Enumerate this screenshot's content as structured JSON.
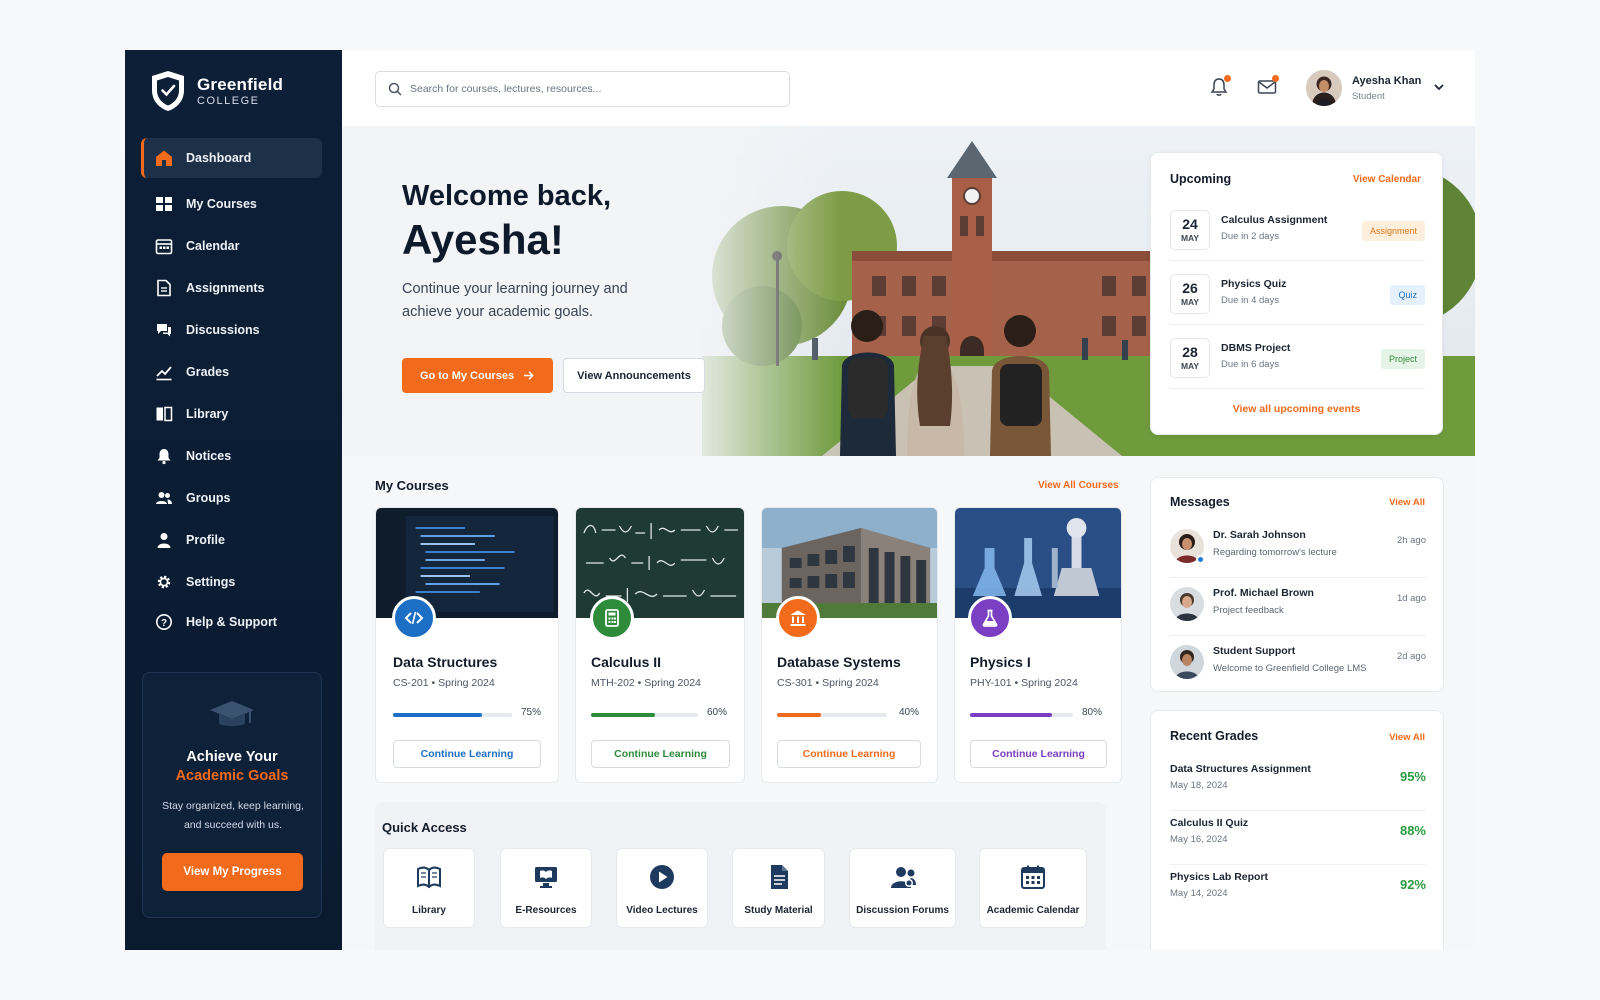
{
  "brand": {
    "name": "Greenfield",
    "sub": "COLLEGE"
  },
  "nav": [
    {
      "label": "Dashboard",
      "icon": "home-icon",
      "active": true
    },
    {
      "label": "My Courses",
      "icon": "courses-icon"
    },
    {
      "label": "Calendar",
      "icon": "calendar-icon"
    },
    {
      "label": "Assignments",
      "icon": "document-icon"
    },
    {
      "label": "Discussions",
      "icon": "chat-icon"
    },
    {
      "label": "Grades",
      "icon": "chart-icon"
    },
    {
      "label": "Library",
      "icon": "book-icon"
    },
    {
      "label": "Notices",
      "icon": "bell-icon"
    },
    {
      "label": "Groups",
      "icon": "group-icon"
    },
    {
      "label": "Profile",
      "icon": "user-icon"
    },
    {
      "label": "Settings",
      "icon": "gear-icon"
    },
    {
      "label": "Help & Support",
      "icon": "help-icon"
    }
  ],
  "goal_card": {
    "title": "Achieve Your",
    "title_accent": "Academic Goals",
    "desc": "Stay organized, keep learning, and succeed with us.",
    "button": "View My Progress"
  },
  "search": {
    "placeholder": "Search for courses, lectures, resources..."
  },
  "user": {
    "name": "Ayesha Khan",
    "role": "Student"
  },
  "hero": {
    "line1": "Welcome back,",
    "line2": "Ayesha!",
    "desc": "Continue your learning journey and achieve your academic goals.",
    "primary_button": "Go to My Courses",
    "secondary_button": "View Announcements"
  },
  "upcoming": {
    "title": "Upcoming",
    "link": "View Calendar",
    "items": [
      {
        "day": "24",
        "month": "MAY",
        "title": "Calculus Assignment",
        "sub": "Due in 2 days",
        "tag": "Assignment"
      },
      {
        "day": "26",
        "month": "MAY",
        "title": "Physics Quiz",
        "sub": "Due in 4 days",
        "tag": "Quiz"
      },
      {
        "day": "28",
        "month": "MAY",
        "title": "DBMS Project",
        "sub": "Due in 6 days",
        "tag": "Project"
      }
    ],
    "footer": "View all upcoming events"
  },
  "courses": {
    "title": "My Courses",
    "link": "View All Courses",
    "items": [
      {
        "name": "Data Structures",
        "code": "CS-201 • Spring 2024",
        "progress": 75,
        "progress_label": "75%",
        "button": "Continue Learning",
        "color": "#1c6fc4",
        "icon": "code-icon"
      },
      {
        "name": "Calculus II",
        "code": "MTH-202 • Spring 2024",
        "progress": 60,
        "progress_label": "60%",
        "button": "Continue Learning",
        "color": "#2e8b3a",
        "icon": "calculator-icon"
      },
      {
        "name": "Database Systems",
        "code": "CS-301 • Spring 2024",
        "progress": 40,
        "progress_label": "40%",
        "button": "Continue Learning",
        "color": "#f26a1b",
        "icon": "building-icon"
      },
      {
        "name": "Physics I",
        "code": "PHY-101 • Spring 2024",
        "progress": 80,
        "progress_label": "80%",
        "button": "Continue Learning",
        "color": "#7b3fc4",
        "icon": "flask-icon"
      }
    ]
  },
  "quick_access": {
    "title": "Quick Access",
    "items": [
      {
        "label": "Library",
        "icon": "book-icon"
      },
      {
        "label": "E-Resources",
        "icon": "monitor-book-icon"
      },
      {
        "label": "Video Lectures",
        "icon": "play-icon"
      },
      {
        "label": "Study Material",
        "icon": "document-icon"
      },
      {
        "label": "Discussion Forums",
        "icon": "forum-icon"
      },
      {
        "label": "Academic Calendar",
        "icon": "calendar-icon"
      }
    ]
  },
  "messages": {
    "title": "Messages",
    "link": "View All",
    "items": [
      {
        "name": "Dr. Sarah Johnson",
        "sub": "Regarding tomorrow's lecture",
        "time": "2h ago"
      },
      {
        "name": "Prof. Michael Brown",
        "sub": "Project feedback",
        "time": "1d ago"
      },
      {
        "name": "Student Support",
        "sub": "Welcome to Greenfield College LMS",
        "time": "2d ago"
      }
    ]
  },
  "grades": {
    "title": "Recent Grades",
    "link": "View All",
    "items": [
      {
        "name": "Data Structures Assignment",
        "date": "May 18, 2024",
        "score": "95%"
      },
      {
        "name": "Calculus II Quiz",
        "date": "May 16, 2024",
        "score": "88%"
      },
      {
        "name": "Physics Lab Report",
        "date": "May 14, 2024",
        "score": "92%"
      }
    ]
  },
  "colors": {
    "accent": "#f26a1b",
    "sidebar": "#0c1f36",
    "success": "#2b9a3e"
  }
}
